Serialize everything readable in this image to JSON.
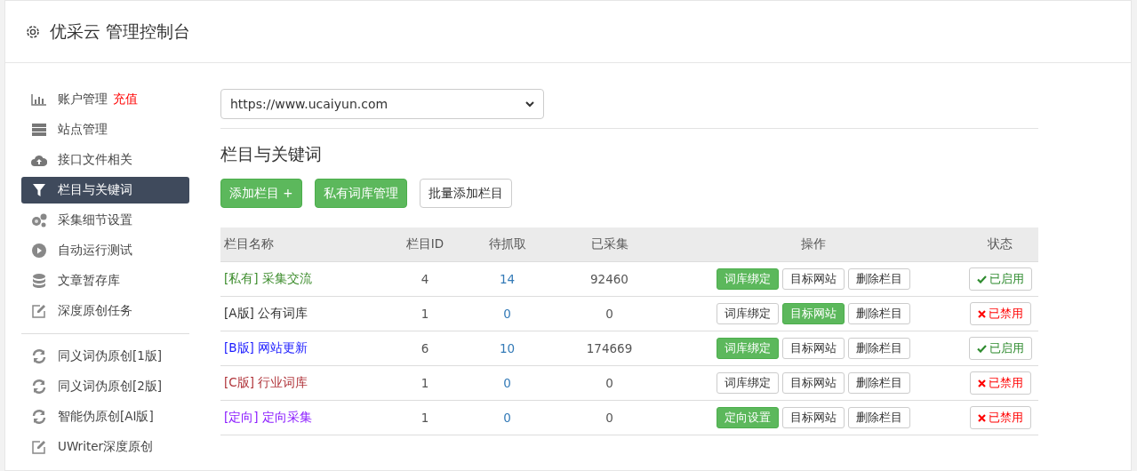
{
  "header": {
    "title": "优采云 管理控制台"
  },
  "sidebar": {
    "groups": [
      [
        {
          "label": "账户管理",
          "badge": "充值",
          "selected": false
        },
        {
          "label": "站点管理",
          "selected": false
        },
        {
          "label": "接口文件相关",
          "selected": false
        },
        {
          "label": "栏目与关键词",
          "selected": true
        },
        {
          "label": "采集细节设置",
          "selected": false
        },
        {
          "label": "自动运行测试",
          "selected": false
        },
        {
          "label": "文章暂存库",
          "selected": false
        },
        {
          "label": "深度原创任务",
          "selected": false
        }
      ],
      [
        {
          "label": "同义词伪原创[1版]",
          "selected": false
        },
        {
          "label": "同义词伪原创[2版]",
          "selected": false
        },
        {
          "label": "智能伪原创[AI版]",
          "selected": false
        },
        {
          "label": "UWriter深度原创",
          "selected": false
        }
      ]
    ]
  },
  "site_select": {
    "value": "https://www.ucaiyun.com"
  },
  "section_title": "栏目与关键词",
  "toolbar": [
    {
      "label": "添加栏目 +",
      "primary": true
    },
    {
      "label": "私有词库管理",
      "primary": true
    },
    {
      "label": "批量添加栏目",
      "primary": false
    }
  ],
  "table": {
    "columns": [
      "栏目名称",
      "栏目ID",
      "待抓取",
      "已采集",
      "操作",
      "状态"
    ],
    "rows": [
      {
        "tag": "[私有]",
        "name": "采集交流",
        "color": "#3c8c2c",
        "id": "4",
        "pending": "14",
        "collected": "92460",
        "actions": [
          {
            "label": "词库绑定",
            "primary": true
          },
          {
            "label": "目标网站",
            "primary": false
          },
          {
            "label": "删除栏目",
            "primary": false
          }
        ],
        "status": "已启用",
        "enabled": true
      },
      {
        "tag": "[A版]",
        "name": "公有词库",
        "color": "#333333",
        "id": "1",
        "pending": "0",
        "collected": "0",
        "actions": [
          {
            "label": "词库绑定",
            "primary": false
          },
          {
            "label": "目标网站",
            "primary": true
          },
          {
            "label": "删除栏目",
            "primary": false
          }
        ],
        "status": "已禁用",
        "enabled": false
      },
      {
        "tag": "[B版]",
        "name": "网站更新",
        "color": "#1a1aff",
        "id": "6",
        "pending": "10",
        "collected": "174669",
        "actions": [
          {
            "label": "词库绑定",
            "primary": true
          },
          {
            "label": "目标网站",
            "primary": false
          },
          {
            "label": "删除栏目",
            "primary": false
          }
        ],
        "status": "已启用",
        "enabled": true
      },
      {
        "tag": "[C版]",
        "name": "行业词库",
        "color": "#b0343a",
        "id": "1",
        "pending": "0",
        "collected": "0",
        "actions": [
          {
            "label": "词库绑定",
            "primary": false
          },
          {
            "label": "目标网站",
            "primary": false
          },
          {
            "label": "删除栏目",
            "primary": false
          }
        ],
        "status": "已禁用",
        "enabled": false
      },
      {
        "tag": "[定向]",
        "name": "定向采集",
        "color": "#8a1aff",
        "id": "1",
        "pending": "0",
        "collected": "0",
        "actions": [
          {
            "label": "定向设置",
            "primary": true
          },
          {
            "label": "目标网站",
            "primary": false
          },
          {
            "label": "删除栏目",
            "primary": false
          }
        ],
        "status": "已禁用",
        "enabled": false
      }
    ]
  }
}
